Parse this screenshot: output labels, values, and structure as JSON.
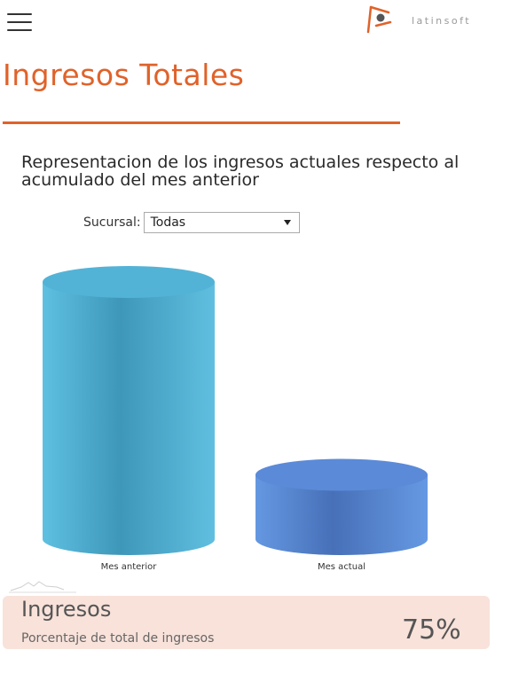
{
  "header": {
    "logo_text": "latinsoft"
  },
  "page": {
    "title": "Ingresos Totales",
    "subtitle": "Representacion de los ingresos actuales respecto al acumulado del mes anterior"
  },
  "filter": {
    "label": "Sucursal:",
    "selected": "Todas"
  },
  "chart_data": {
    "type": "bar",
    "categories": [
      "Mes anterior",
      "Mes actual"
    ],
    "values": [
      100,
      25
    ],
    "colors": [
      "#53b3d6",
      "#5b8ad8"
    ],
    "style": "3d-cylinder"
  },
  "kpi": {
    "title": "Ingresos",
    "subtitle": "Porcentaje de total de ingresos",
    "value": "75%"
  },
  "colors": {
    "accent": "#e0622a",
    "card_bg": "#f8e2da"
  }
}
